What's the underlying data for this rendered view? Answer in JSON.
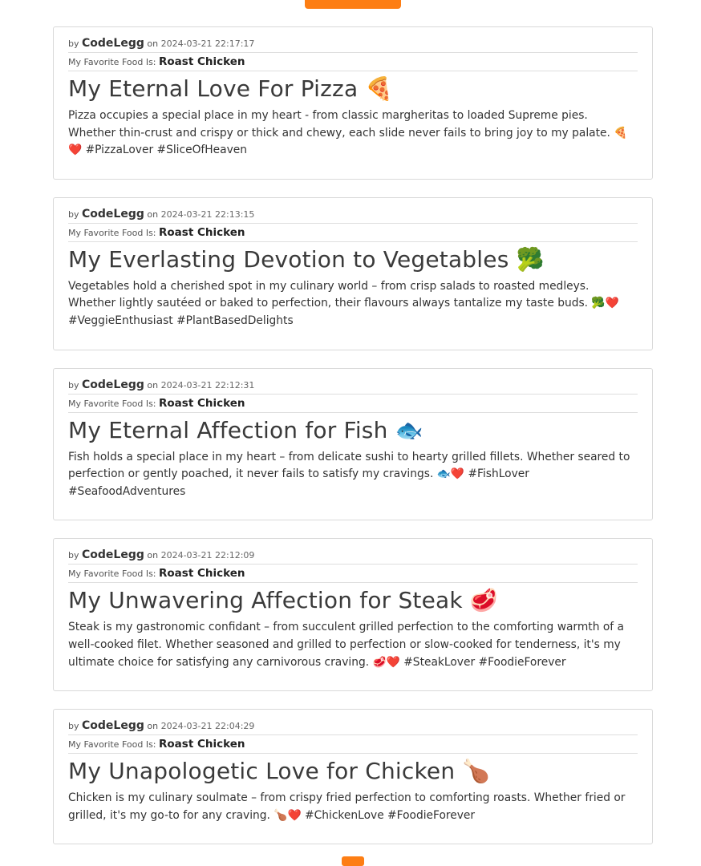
{
  "labels": {
    "by": "by",
    "on": "on",
    "favorite_prefix": "My Favorite Food Is:"
  },
  "colors": {
    "accent": "#fd7e14",
    "border": "#d9d9d9"
  },
  "posts": [
    {
      "author": "CodeLegg",
      "date": "2024-03-21 22:17:17",
      "favorite_food": "Roast Chicken",
      "title": "My Eternal Love For Pizza 🍕",
      "body": "Pizza occupies a special place in my heart - from classic margheritas to loaded Supreme pies. Whether thin-crust and crispy or thick and chewy, each slide never fails to bring joy to my palate. 🍕❤️ #PizzaLover #SliceOfHeaven"
    },
    {
      "author": "CodeLegg",
      "date": "2024-03-21 22:13:15",
      "favorite_food": "Roast Chicken",
      "title": "My Everlasting Devotion to Vegetables 🥦",
      "body": "Vegetables hold a cherished spot in my culinary world – from crisp salads to roasted medleys. Whether lightly sautéed or baked to perfection, their flavours always tantalize my taste buds. 🥦❤️ #VeggieEnthusiast #PlantBasedDelights"
    },
    {
      "author": "CodeLegg",
      "date": "2024-03-21 22:12:31",
      "favorite_food": "Roast Chicken",
      "title": "My Eternal Affection for Fish 🐟",
      "body": "Fish holds a special place in my heart – from delicate sushi to hearty grilled fillets. Whether seared to perfection or gently poached, it never fails to satisfy my cravings. 🐟❤️ #FishLover #SeafoodAdventures"
    },
    {
      "author": "CodeLegg",
      "date": "2024-03-21 22:12:09",
      "favorite_food": "Roast Chicken",
      "title": "My Unwavering Affection for Steak 🥩",
      "body": "Steak is my gastronomic confidant – from succulent grilled perfection to the comforting warmth of a well-cooked filet. Whether seasoned and grilled to perfection or slow-cooked for tenderness, it's my ultimate choice for satisfying any carnivorous craving. 🥩❤️ #SteakLover #FoodieForever"
    },
    {
      "author": "CodeLegg",
      "date": "2024-03-21 22:04:29",
      "favorite_food": "Roast Chicken",
      "title": "My Unapologetic Love for Chicken 🍗",
      "body": "Chicken is my culinary soulmate – from crispy fried perfection to comforting roasts. Whether fried or grilled, it's my go-to for any craving. 🍗❤️ #ChickenLove #FoodieForever"
    }
  ]
}
